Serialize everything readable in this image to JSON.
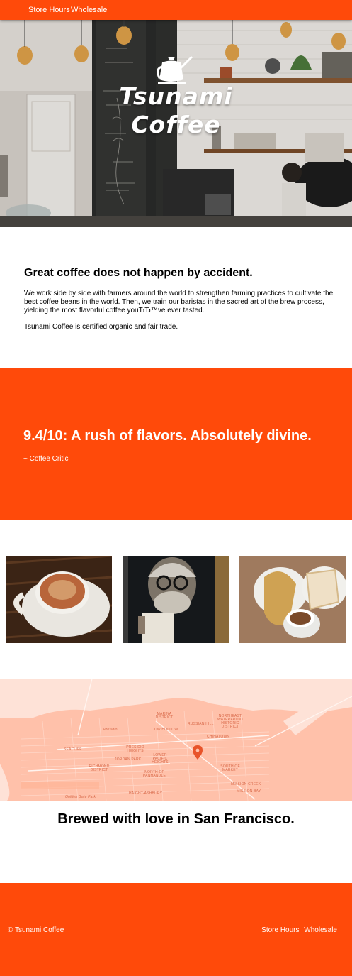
{
  "nav": {
    "store_hours": "Store Hours",
    "wholesale": "Wholesale"
  },
  "hero": {
    "title_line1": "Tsunami",
    "title_line2": "Coffee"
  },
  "about": {
    "heading": "Great coffee does not happen by accident.",
    "para1": "We work side by side with farmers around the world to strengthen farming practices to cultivate the best coffee beans in the world. Then, we train our baristas in the sacred art of the brew process, yielding the most flavorful coffee youЂЂ™ve ever tasted.",
    "para2": "Tsunami Coffee is certified organic and fair trade."
  },
  "quote": {
    "text": "9.4/10: A rush of flavors. Absolutely divine.",
    "cite": "~ Coffee Critic"
  },
  "map": {
    "labels": {
      "marina": "MARINA DISTRICT",
      "russian_hill": "RUSSIAN HILL",
      "northeast_waterfront": "NORTHEAST WATERFRONT HISTORIC DISTRICT",
      "presidio": "Presidio",
      "cow_hollow": "COW HOLLOW",
      "chinatown": "CHINATOWN",
      "seacliff": "SEACLIFF",
      "presidio_heights": "PRESIDIO HEIGHTS",
      "lower_pacific_heights": "LOWER PACIFIC HEIGHTS",
      "jordan_park": "JORDAN PARK",
      "richmond_district": "RICHMOND DISTRICT",
      "north_of_panhandle": "NORTH OF PANHANDLE",
      "south_of_market": "SOUTH OF MARKET",
      "golden_gate_park": "Golden Gate Park",
      "haight_ashbury": "HAIGHT-ASHBURY",
      "mission_creek": "MISSION CREEK",
      "mission_bay": "MISSION BAY"
    },
    "pin_color": "#e8542a"
  },
  "location": {
    "heading": "Brewed with love in San Francisco."
  },
  "footer": {
    "copyright": "© Tsunami Coffee",
    "store_hours": "Store Hours",
    "wholesale": "Wholesale"
  },
  "colors": {
    "brand": "#ff4a0a",
    "map_background": "#ffc1aa"
  }
}
